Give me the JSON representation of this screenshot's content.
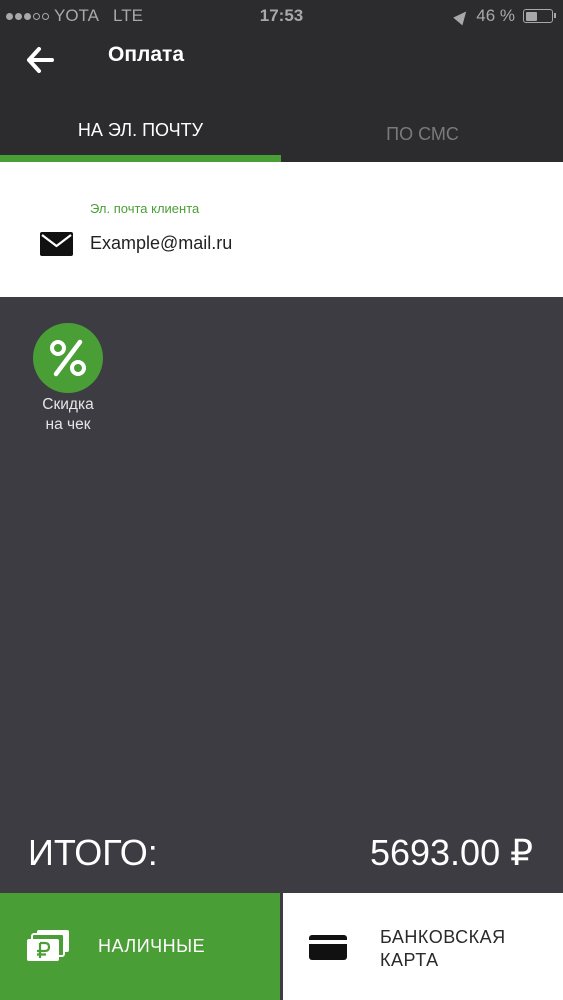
{
  "status_bar": {
    "carrier": "YOTA",
    "network": "LTE",
    "time": "17:53",
    "battery": "46 %",
    "battery_level": 0.46
  },
  "header": {
    "title": "Оплата",
    "back_icon": "arrow-left-icon"
  },
  "tabs": [
    {
      "label": "НА ЭЛ. ПОЧТУ",
      "active": true
    },
    {
      "label": "ПО СМС",
      "active": false
    }
  ],
  "email": {
    "label": "Эл. почта клиента",
    "value": "Example@mail.ru",
    "icon": "mail-icon"
  },
  "discount": {
    "line1": "Скидка",
    "line2": "на чек",
    "icon": "percent-icon"
  },
  "total": {
    "label": "ИТОГО:",
    "value": "5693.00 ₽"
  },
  "payment": {
    "cash_label": "НАЛИЧНЫЕ",
    "cash_icon": "cash-icon",
    "card_line1": "БАНКОВСКАЯ",
    "card_line2": "КАРТА",
    "card_icon": "card-icon"
  },
  "colors": {
    "accent": "#4a9e36",
    "header_bg": "#2c2c2e",
    "body_bg": "#3c3c42"
  }
}
